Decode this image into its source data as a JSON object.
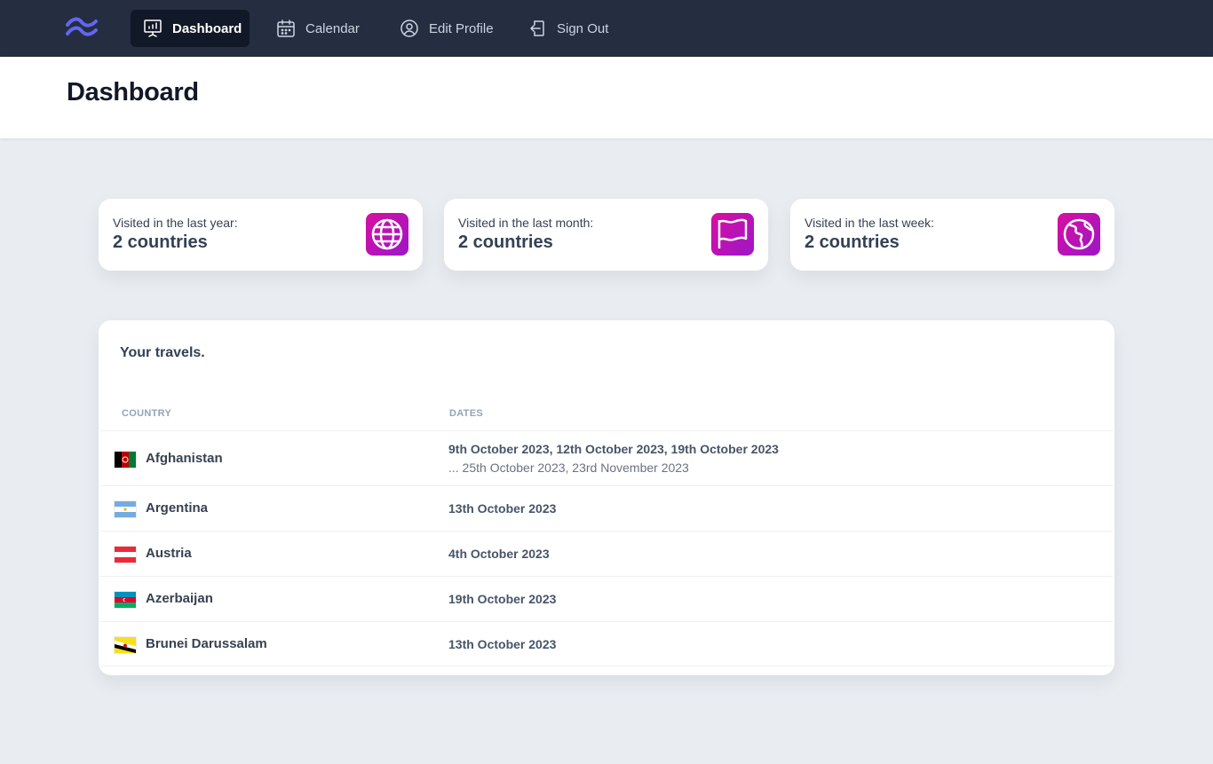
{
  "nav": {
    "items": [
      {
        "label": "Dashboard",
        "icon": "presentation-chart-icon",
        "active": true
      },
      {
        "label": "Calendar",
        "icon": "calendar-icon",
        "active": false
      },
      {
        "label": "Edit Profile",
        "icon": "user-circle-icon",
        "active": false
      },
      {
        "label": "Sign Out",
        "icon": "sign-out-icon",
        "active": false
      }
    ],
    "logo_color": "#6366f1"
  },
  "header": {
    "title": "Dashboard"
  },
  "stats": [
    {
      "label": "Visited in the last year:",
      "value": "2 countries",
      "icon": "globe-icon"
    },
    {
      "label": "Visited in the last month:",
      "value": "2 countries",
      "icon": "flag-icon"
    },
    {
      "label": "Visited in the last week:",
      "value": "2 countries",
      "icon": "globe-americas-icon"
    }
  ],
  "travels": {
    "title": "Your travels.",
    "columns": [
      "COUNTRY",
      "DATES"
    ],
    "rows": [
      {
        "country": "Afghanistan",
        "dates": "9th October 2023, 12th October 2023, 19th October 2023",
        "more": "... 25th October 2023, 23rd November 2023",
        "flag": "afghanistan-flag"
      },
      {
        "country": "Argentina",
        "dates": "13th October 2023",
        "flag": "argentina-flag"
      },
      {
        "country": "Austria",
        "dates": "4th October 2023",
        "flag": "austria-flag"
      },
      {
        "country": "Azerbaijan",
        "dates": "19th October 2023",
        "flag": "azerbaijan-flag"
      },
      {
        "country": "Brunei Darussalam",
        "dates": "13th October 2023",
        "flag": "brunei-flag"
      }
    ]
  },
  "colors": {
    "nav_bg": "#252d40",
    "nav_active_bg": "#111827",
    "page_bg": "#e9edf2",
    "icon_gradient_start": "#d80fa0",
    "icon_gradient_end": "#9c16c9"
  }
}
